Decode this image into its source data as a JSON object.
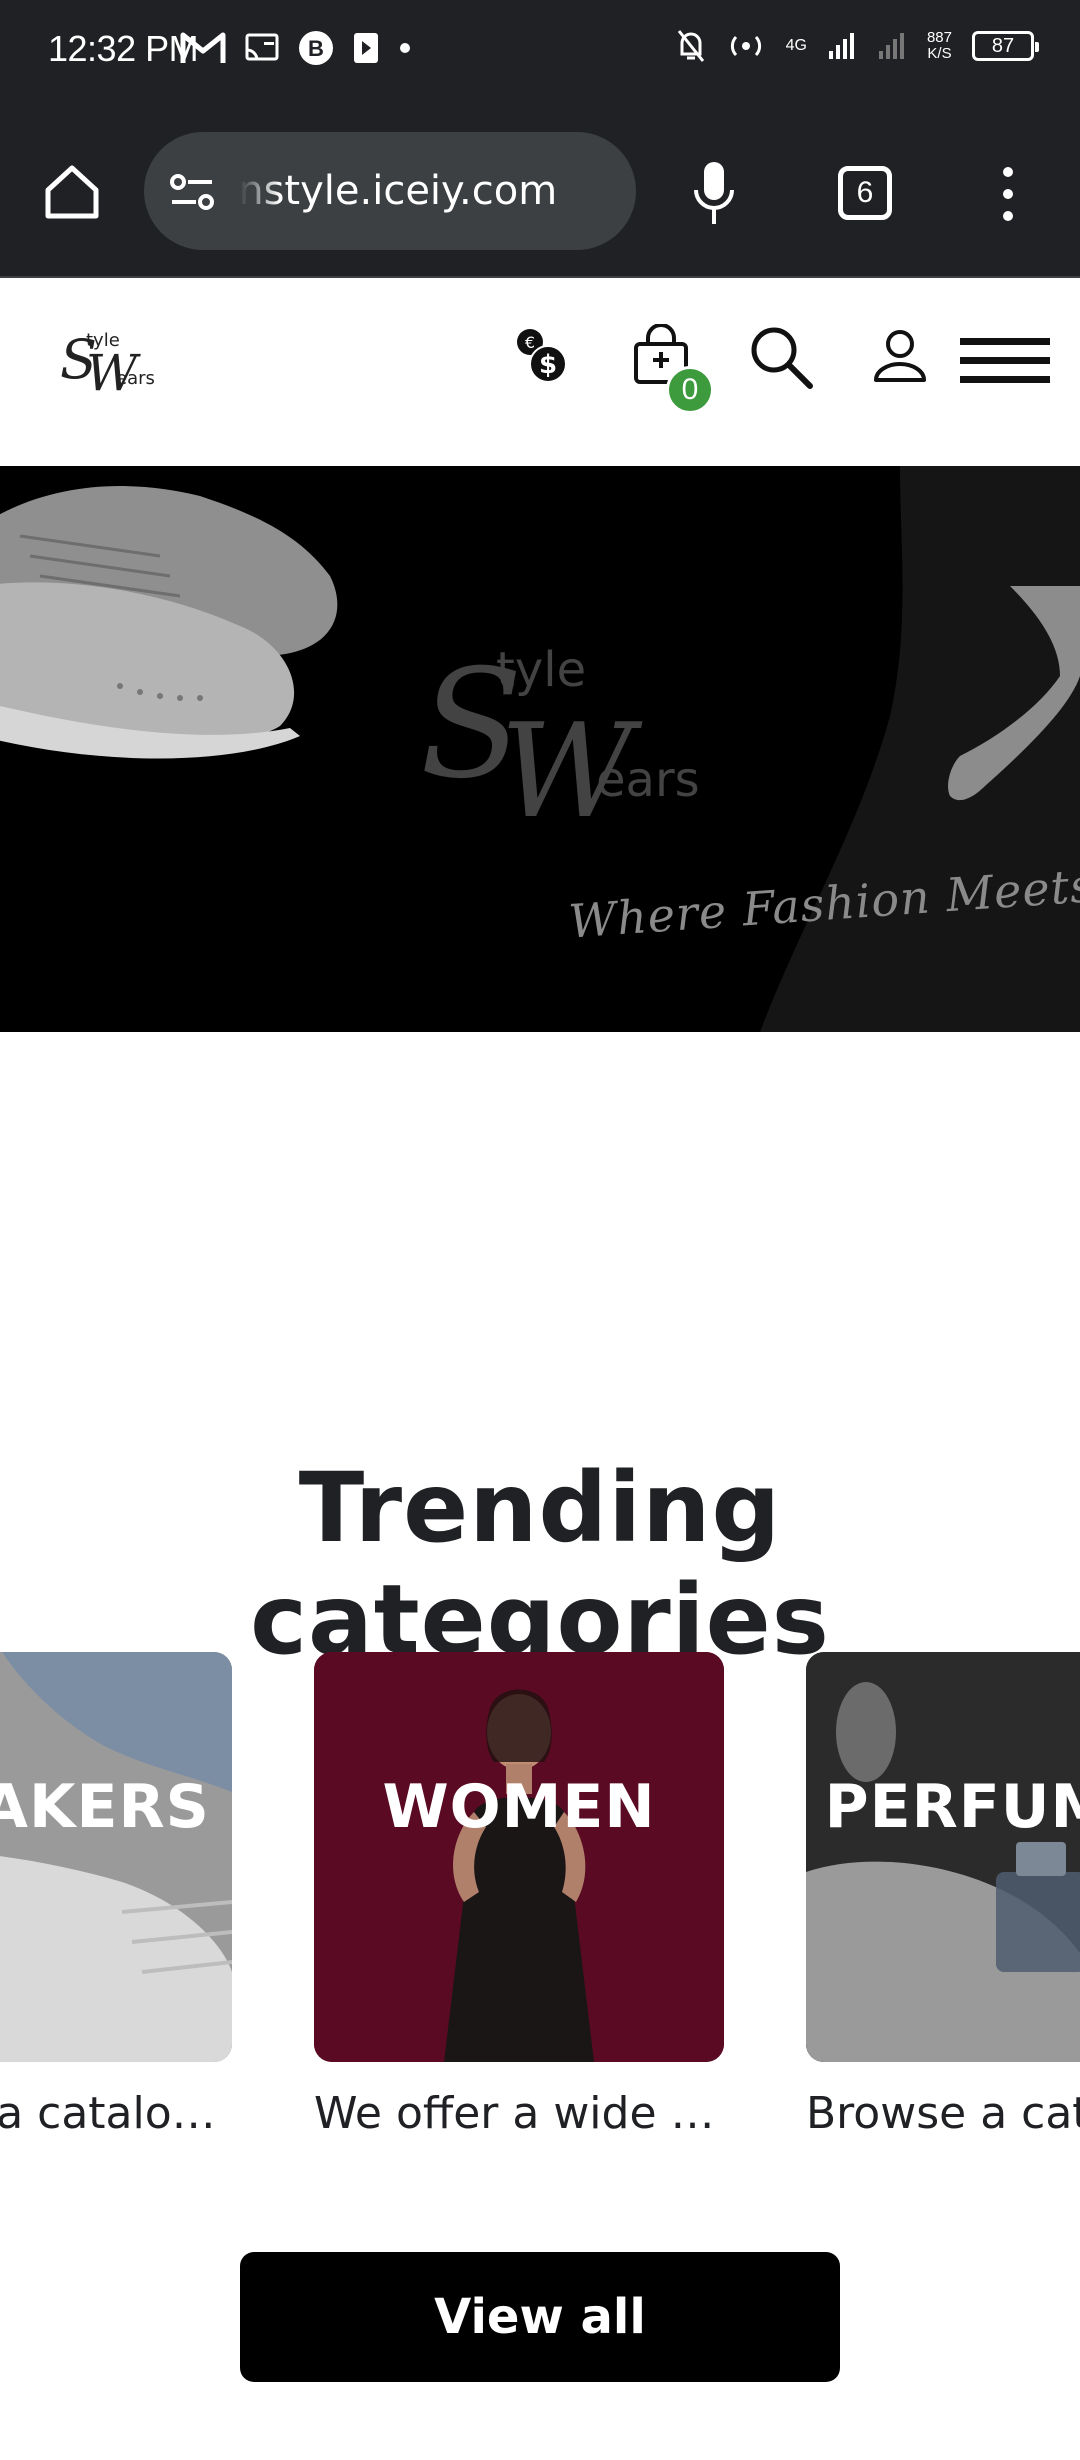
{
  "status_bar": {
    "time": "12:32 PM",
    "network": "4G",
    "speed_value": "887",
    "speed_unit": "K/S",
    "battery": "87"
  },
  "browser": {
    "url": "wearsinstyle.iceiy.com",
    "tab_count": "6"
  },
  "header": {
    "cart_count": "0",
    "icons": [
      "currency-switch-icon",
      "cart-icon",
      "search-icon",
      "account-icon",
      "hamburger-menu-icon"
    ]
  },
  "hero": {
    "tagline": "Where Fashion Meets Elegance"
  },
  "trending": {
    "title": "Trending categories",
    "categories": [
      {
        "label": "SNEAKERS",
        "description": "Browse a catalog of sneakers"
      },
      {
        "label": "WOMEN",
        "description": "We offer a wide range of women's fashion"
      },
      {
        "label": "PERFUMES",
        "description": "Browse a catalog of perfumes"
      }
    ],
    "view_all_label": "View all"
  },
  "colors": {
    "chrome_bg": "#202124",
    "urlbar_bg": "#3c4043",
    "cart_badge": "#3d9a3d",
    "women_card_bg": "#5a0a22",
    "text_dark": "#202124"
  }
}
